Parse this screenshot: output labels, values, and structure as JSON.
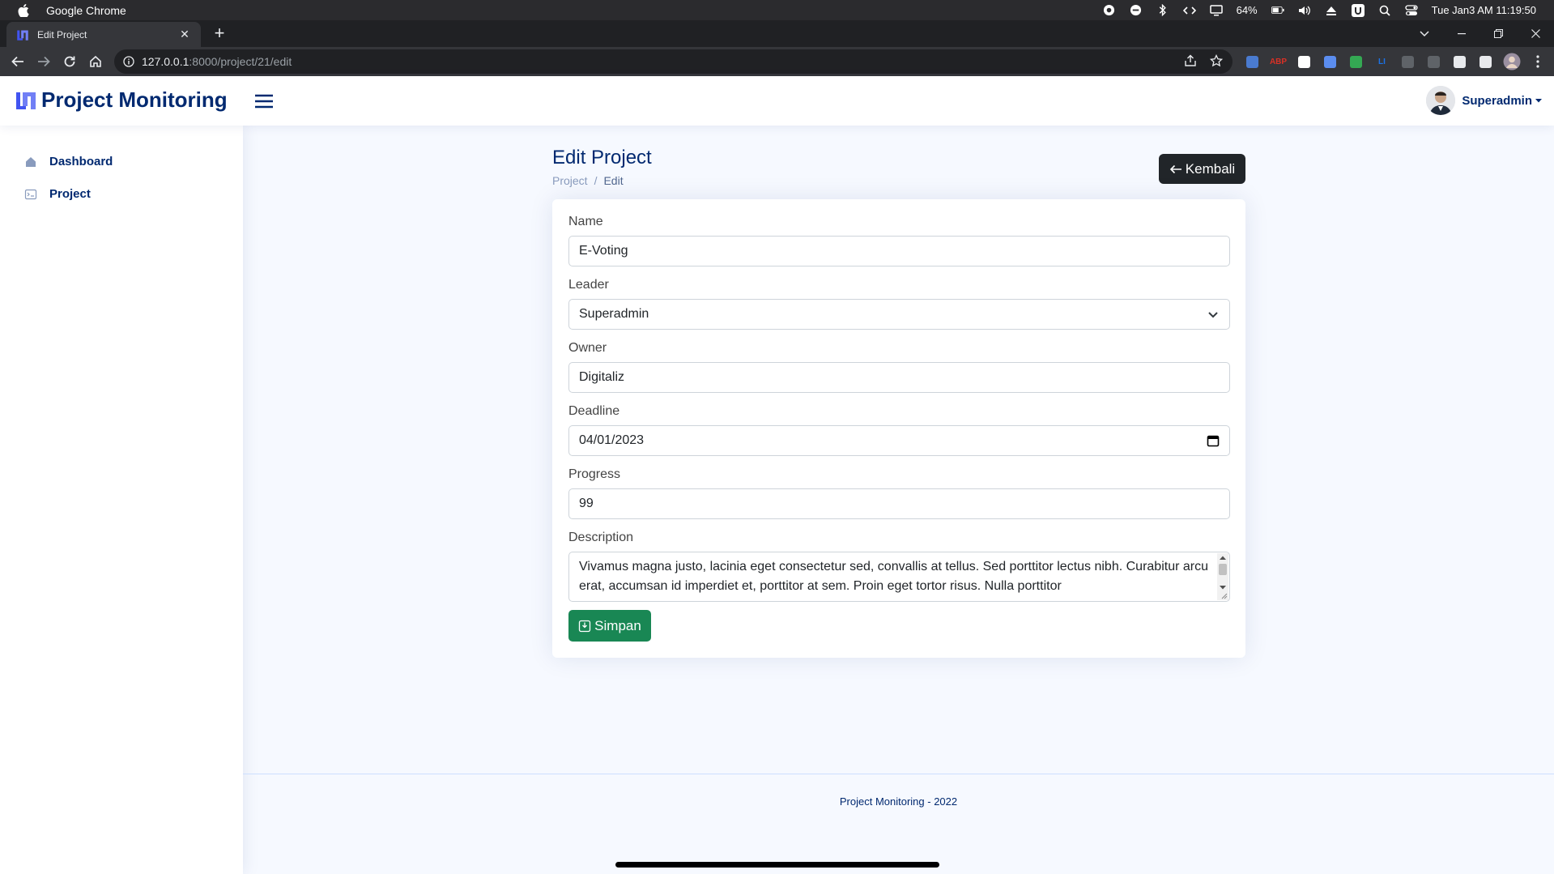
{
  "os": {
    "app_name": "Google Chrome",
    "battery": "64%",
    "clock": "Tue Jan3 AM 11:19:50"
  },
  "browser": {
    "tab_title": "Edit Project",
    "url_host": "127.0.0.1",
    "url_path": ":8000/project/21/edit",
    "extensions": [
      {
        "name": "translate-icon",
        "label": "",
        "color": "#4a7bd0"
      },
      {
        "name": "adblock-icon",
        "label": "ABP",
        "color": "#d93025"
      },
      {
        "name": "circle-extension-icon",
        "label": "",
        "color": "#ffffff"
      },
      {
        "name": "screen-capture-icon",
        "label": "",
        "color": "#5b8def"
      },
      {
        "name": "color-picker-icon",
        "label": "",
        "color": "#34a853"
      },
      {
        "name": "li-extension-icon",
        "label": "LI",
        "color": "#1a73e8"
      },
      {
        "name": "disabled-extension-icon",
        "label": "",
        "color": "#5f6368"
      },
      {
        "name": "recycle-extension-icon",
        "label": "",
        "color": "#5f6368"
      },
      {
        "name": "puzzle-icon",
        "label": "",
        "color": "#e8eaed"
      },
      {
        "name": "sidepanel-icon",
        "label": "",
        "color": "#e8eaed"
      }
    ]
  },
  "header": {
    "brand": "Project Monitoring",
    "user_name": "Superadmin"
  },
  "sidebar": {
    "items": [
      {
        "label": "Dashboard",
        "icon": "grid-icon"
      },
      {
        "label": "Project",
        "icon": "document-icon"
      }
    ]
  },
  "page": {
    "title": "Edit Project",
    "breadcrumb": [
      "Project",
      "Edit"
    ],
    "back_button": "Kembali"
  },
  "form": {
    "name_label": "Name",
    "name_value": "E-Voting",
    "leader_label": "Leader",
    "leader_value": "Superadmin",
    "owner_label": "Owner",
    "owner_value": "Digitaliz",
    "deadline_label": "Deadline",
    "deadline_value": "04/01/2023",
    "progress_label": "Progress",
    "progress_value": "99",
    "description_label": "Description",
    "description_value": "Vivamus magna justo, lacinia eget consectetur sed, convallis at tellus. Sed porttitor lectus nibh. Curabitur arcu erat, accumsan id imperdiet et, porttitor at sem. Proin eget tortor risus. Nulla porttitor",
    "save_button": "Simpan"
  },
  "footer": {
    "text": "Project Monitoring - 2022"
  },
  "colors": {
    "brand": "#012970",
    "accent": "#4154f1",
    "save": "#198754",
    "back": "#212529"
  }
}
